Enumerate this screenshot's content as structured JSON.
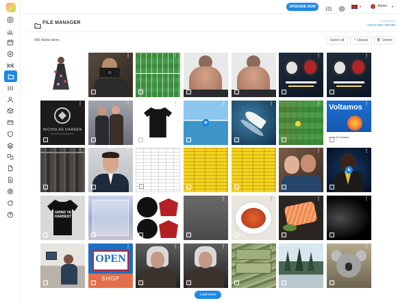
{
  "topbar": {
    "upgrade_label": "UPGRADE NOW",
    "user_label": "Admin",
    "language": "English (UK)"
  },
  "sidebar": {
    "items": [
      {
        "icon": "instagram-icon"
      },
      {
        "icon": "bar-chart-icon"
      },
      {
        "icon": "calendar-icon"
      },
      {
        "icon": "add-circle-icon"
      },
      {
        "icon": "command-icon"
      },
      {
        "icon": "folder-icon",
        "active": true
      },
      {
        "icon": "sliders-icon"
      },
      {
        "icon": "user-icon"
      },
      {
        "icon": "box-icon"
      },
      {
        "icon": "credit-card-icon"
      },
      {
        "icon": "shield-icon"
      },
      {
        "icon": "layers-icon"
      },
      {
        "icon": "translate-icon"
      },
      {
        "icon": "file-icon"
      },
      {
        "icon": "file-text-icon"
      },
      {
        "icon": "settings-icon"
      },
      {
        "icon": "refresh-icon"
      },
      {
        "icon": "help-icon"
      }
    ]
  },
  "header": {
    "title": "FILE MANAGER",
    "storage_label": "STORAGE",
    "storage_value": "134.07 MB / 500 MB"
  },
  "toolbar": {
    "media_count": "586 Media items",
    "select_all": "Select all",
    "upload": "Upload",
    "delete": "Delete"
  },
  "tiles": {
    "nicholas_name": "NICHOLAS DARDEN",
    "nicholas_sub": "PHOTOGRAPHY",
    "voltamos": "Voltamos",
    "voltamos_sub": "cada 15 minutos",
    "grind_text": "GRIND YA HARDEST",
    "open_text": "OPEN",
    "shop_text": "SHOP"
  },
  "footer": {
    "load_more": "Load more"
  },
  "colors": {
    "accent": "#1e88e5"
  }
}
